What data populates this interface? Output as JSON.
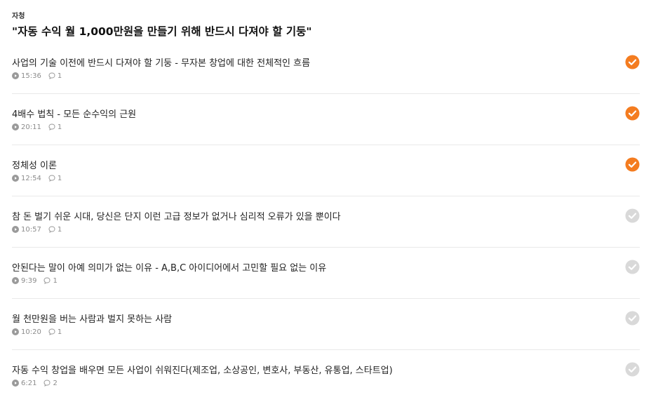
{
  "course": {
    "author": "자청",
    "title": "\"자동 수익 월 1,000만원을 만들기 위해 반드시 다져야 할 기둥\""
  },
  "colors": {
    "done": "#f47c20",
    "not_done": "#d9d9d9",
    "meta": "#8c8c8c"
  },
  "lessons": [
    {
      "title": "사업의 기술 이전에 반드시 다져야 할 기둥 - 무자본 창업에 대한 전체적인 흐름",
      "duration": "15:36",
      "comments": "1",
      "completed": true
    },
    {
      "title": "4배수 법칙 - 모든 순수익의 근원",
      "duration": "20:11",
      "comments": "1",
      "completed": true
    },
    {
      "title": "정체성 이론",
      "duration": "12:54",
      "comments": "1",
      "completed": true
    },
    {
      "title": "참 돈 벌기 쉬운 시대, 당신은 단지 이런 고급 정보가 없거나 심리적 오류가 있을 뿐이다",
      "duration": "10:57",
      "comments": "1",
      "completed": false
    },
    {
      "title": "안된다는 말이 아예 의미가 없는 이유 - A,B,C 아이디어에서 고민할 필요 없는 이유",
      "duration": "9:39",
      "comments": "1",
      "completed": false
    },
    {
      "title": "월 천만원을 버는 사람과 벌지 못하는 사람",
      "duration": "10:20",
      "comments": "1",
      "completed": false
    },
    {
      "title": "자동 수익 창업을 배우면 모든 사업이 쉬워진다(제조업, 소상공인, 변호사, 부동산, 유통업, 스타트업)",
      "duration": "6:21",
      "comments": "2",
      "completed": false
    }
  ]
}
